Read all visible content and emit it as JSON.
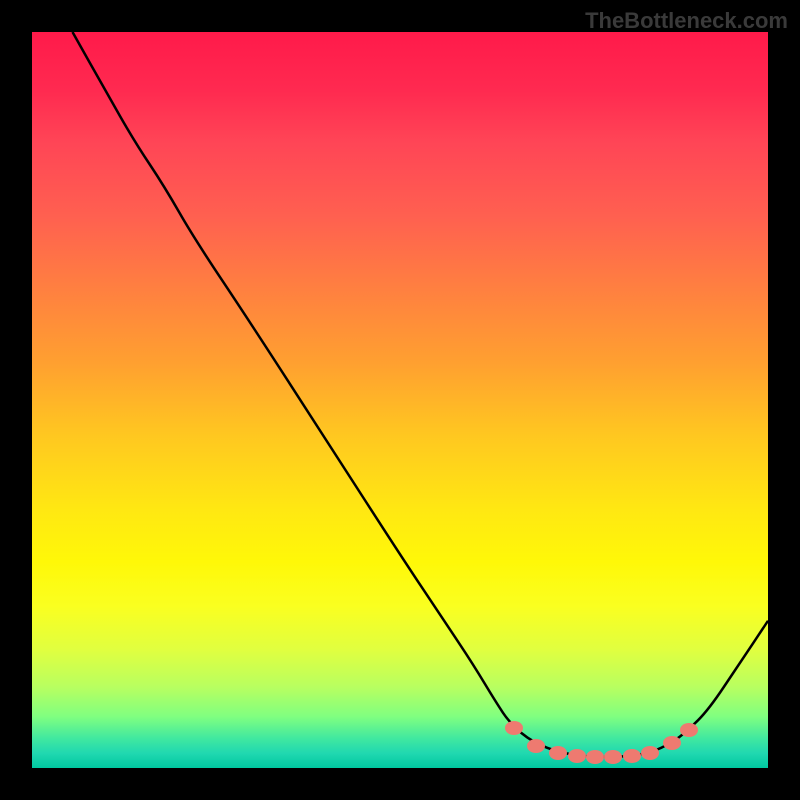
{
  "watermark": "TheBottleneck.com",
  "chart_data": {
    "type": "line",
    "title": "",
    "xlabel": "",
    "ylabel": "",
    "xlim": [
      0,
      100
    ],
    "ylim": [
      0,
      100
    ],
    "curve_points": [
      {
        "x": 5.5,
        "y": 100
      },
      {
        "x": 10,
        "y": 92
      },
      {
        "x": 14,
        "y": 85
      },
      {
        "x": 18,
        "y": 79
      },
      {
        "x": 22,
        "y": 72
      },
      {
        "x": 30,
        "y": 60
      },
      {
        "x": 40,
        "y": 44.5
      },
      {
        "x": 50,
        "y": 29
      },
      {
        "x": 56,
        "y": 20
      },
      {
        "x": 60,
        "y": 14
      },
      {
        "x": 63,
        "y": 9
      },
      {
        "x": 65,
        "y": 6
      },
      {
        "x": 68,
        "y": 3.5
      },
      {
        "x": 72,
        "y": 2
      },
      {
        "x": 76,
        "y": 1.5
      },
      {
        "x": 80,
        "y": 1.5
      },
      {
        "x": 84,
        "y": 2
      },
      {
        "x": 87,
        "y": 3.5
      },
      {
        "x": 89,
        "y": 5
      },
      {
        "x": 92,
        "y": 8
      },
      {
        "x": 96,
        "y": 14
      },
      {
        "x": 100,
        "y": 20
      }
    ],
    "markers": [
      {
        "x": 65.5,
        "y": 5.5
      },
      {
        "x": 68.5,
        "y": 3.0
      },
      {
        "x": 71.5,
        "y": 2.0
      },
      {
        "x": 74,
        "y": 1.7
      },
      {
        "x": 76.5,
        "y": 1.5
      },
      {
        "x": 79,
        "y": 1.5
      },
      {
        "x": 81.5,
        "y": 1.7
      },
      {
        "x": 84,
        "y": 2.1
      },
      {
        "x": 87,
        "y": 3.4
      },
      {
        "x": 89.3,
        "y": 5.2
      }
    ],
    "gradient_description": "vertical gradient from red (high bottleneck) at top through orange, yellow, to green (low bottleneck) at bottom"
  }
}
